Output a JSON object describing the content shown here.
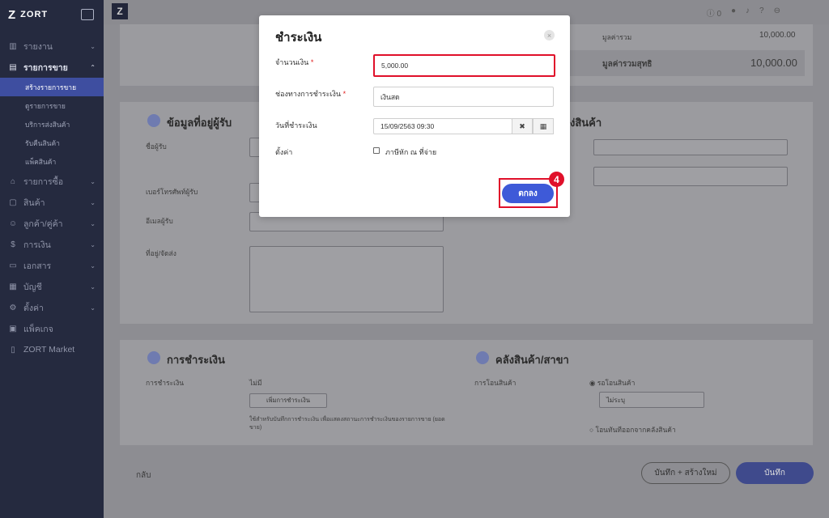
{
  "brand": {
    "logo": "Z",
    "name": "ZORT"
  },
  "sidebar": {
    "items": [
      {
        "label": "รายงาน",
        "icon": "chart-icon",
        "chevron": "⌄"
      },
      {
        "label": "รายการขาย",
        "icon": "sales-icon",
        "chevron": "⌃"
      },
      {
        "label": "รายการซื้อ",
        "icon": "purchase-icon",
        "chevron": "⌄"
      },
      {
        "label": "สินค้า",
        "icon": "box-icon",
        "chevron": "⌄"
      },
      {
        "label": "ลูกค้า/คู่ค้า",
        "icon": "people-icon",
        "chevron": "⌄"
      },
      {
        "label": "การเงิน",
        "icon": "money-icon",
        "chevron": "⌄"
      },
      {
        "label": "เอกสาร",
        "icon": "document-icon",
        "chevron": "⌄"
      },
      {
        "label": "บัญชี",
        "icon": "ledger-icon",
        "chevron": "⌄"
      },
      {
        "label": "ตั้งค่า",
        "icon": "gear-icon",
        "chevron": "⌄"
      },
      {
        "label": "แพ็คเกจ",
        "icon": "package-icon",
        "chevron": ""
      },
      {
        "label": "ZORT Market",
        "icon": "market-icon",
        "chevron": ""
      }
    ],
    "sales_sub": [
      "สร้างรายการขาย",
      "ดูรายการขาย",
      "บริการส่งสินค้า",
      "รับคืนสินค้า",
      "แพ็คสินค้า"
    ]
  },
  "topbar": {
    "notifications_count": "0"
  },
  "background": {
    "total_label": "มูลค่ารวม",
    "total_value": "10,000.00",
    "net_label": "มูลค่ารวมสุทธิ",
    "net_value": "10,000.00",
    "recipient_title": "ข้อมูลที่อยู่ผู้รับ",
    "recipient_name": "ชื่อผู้รับ",
    "recipient_phone": "เบอร์โทรศัพท์ผู้รับ",
    "recipient_email": "อีเมลผู้รับ",
    "recipient_address": "ที่อยู่/จัดส่ง",
    "shipping_title": "ง่สินค้า",
    "payment_title": "การชำระเงิน",
    "payment_label": "การชำระเงิน",
    "payment_none": "ไม่มี",
    "add_payment": "เพิ่มการชำระเงิน",
    "payment_note": "ใช้สำหรับบันทึกการชำระเงิน เพื่อแสดงสถานะการชำระเงินของรายการขาย (ยอดขาย)",
    "warehouse_title": "คลังสินค้า/สาขา",
    "transfer_label": "การโอนสินค้า",
    "transfer_wait": "รอโอนสินค้า",
    "unspecified": "ไม่ระบุ",
    "transfer_now": "โอนทันทีออกจากคลังสินค้า",
    "back": "กลับ",
    "save_new": "บันทึก + สร้างใหม่",
    "save": "บันทึก"
  },
  "modal": {
    "title": "ชำระเงิน",
    "close_icon": "×",
    "amount_label": "จำนวนเงิน",
    "amount_value": "5,000.00",
    "channel_label": "ช่องทางการชำระเงิน",
    "channel_value": "เงินสด",
    "date_label": "วันที่ชำระเงิน",
    "date_value": "15/09/2563 09:30",
    "clear_icon": "✖",
    "calendar_icon": "▦",
    "settings_label": "ตั้งค่า",
    "withholding_label": "ภาษีหัก ณ ที่จ่าย",
    "ok_label": "ตกลง",
    "required_mark": "*",
    "step_badge": "4"
  }
}
